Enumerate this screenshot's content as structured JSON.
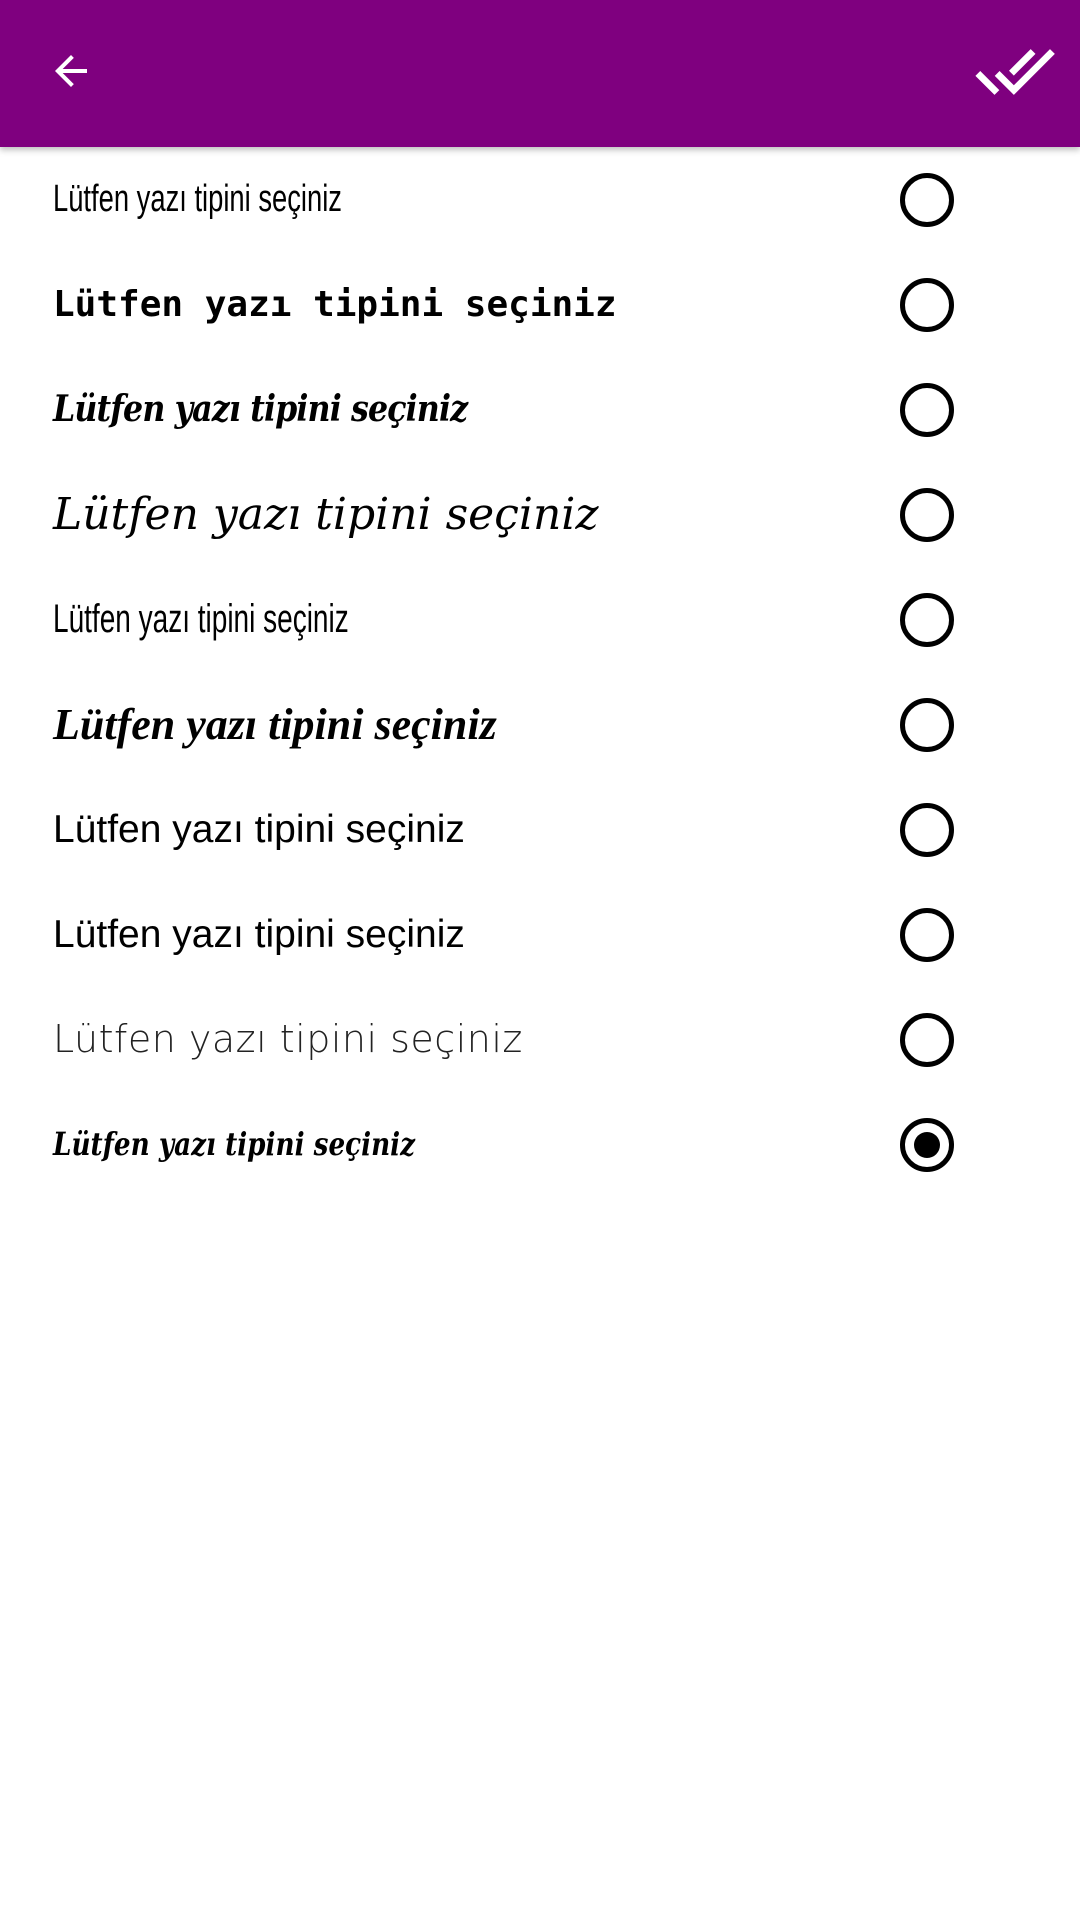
{
  "toolbar": {
    "background": "#7f007f",
    "back_icon": "arrow-back-icon",
    "done_icon": "done-all-icon"
  },
  "fonts": {
    "selected_index": 9,
    "items": [
      {
        "label": "Lütfen yazı tipini seçiniz",
        "selected": false
      },
      {
        "label": "Lütfen yazı tipini seçiniz",
        "selected": false
      },
      {
        "label": "Lütfen yazı tipini seçiniz",
        "selected": false
      },
      {
        "label": "Lütfen yazı tipini seçiniz",
        "selected": false
      },
      {
        "label": "Lütfen yazı tipini seçiniz",
        "selected": false
      },
      {
        "label": "Lütfen yazı tipini seçiniz",
        "selected": false
      },
      {
        "label": "Lütfen yazı tipini seçiniz",
        "selected": false
      },
      {
        "label": "Lütfen yazı tipini seçiniz",
        "selected": false
      },
      {
        "label": "Lütfen yazı tipini seçiniz",
        "selected": false
      },
      {
        "label": "Lütfen yazı tipini seçiniz",
        "selected": true
      }
    ]
  }
}
